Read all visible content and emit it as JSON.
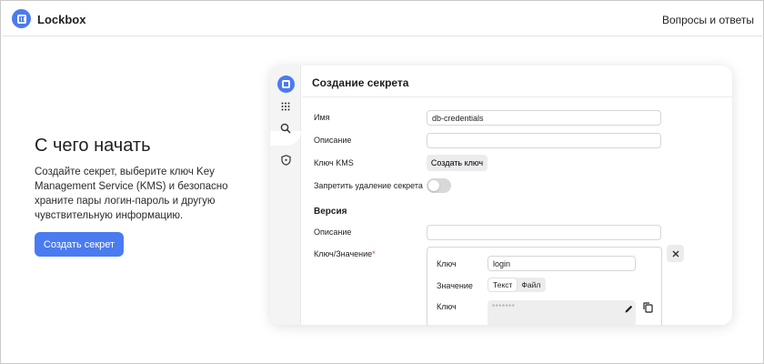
{
  "header": {
    "app_name": "Lockbox",
    "faq_link": "Вопросы и ответы"
  },
  "hero": {
    "title": "С чего начать",
    "description": "Создайте секрет, выберите ключ Key Management Service (KMS) и безопасно храните пары логин-пароль и другую чувствительную информацию.",
    "create_button": "Создать секрет"
  },
  "panel": {
    "title": "Создание секрета",
    "name_label": "Имя",
    "name_value": "db-credentials",
    "description_label": "Описание",
    "description_value": "",
    "kms_label": "Ключ KMS",
    "kms_button": "Создать ключ",
    "delete_protection_label": "Запретить удаление секрета",
    "delete_protection_on": false,
    "version_title": "Версия",
    "version_description_label": "Описание",
    "version_description_value": "",
    "kv_label": "Ключ/Значение",
    "kv_required_mark": "*",
    "entry": {
      "key_label": "Ключ",
      "key_value": "login",
      "value_label": "Значение",
      "value_type_options": [
        "Текст",
        "Файл"
      ],
      "value_type_selected": "Текст",
      "secret_key_label": "Ключ",
      "secret_mask": "*******"
    }
  },
  "rail_icons": [
    "lockbox-logo-icon",
    "grid-icon",
    "search-icon",
    "shield-icon"
  ],
  "colors": {
    "accent": "#4a7bf0",
    "required": "#e0433b"
  }
}
